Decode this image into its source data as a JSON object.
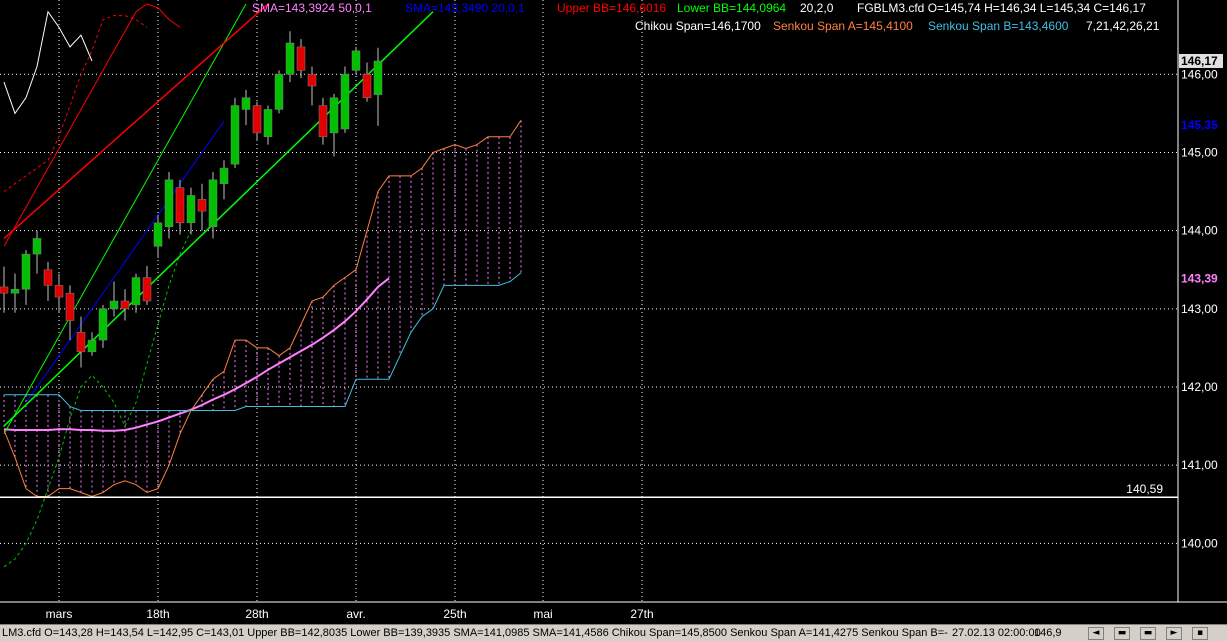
{
  "indicators": {
    "sma1": "SMA=143,3924  50,0,1",
    "sma2": "SMA=145,3490  20,0,1",
    "upper_bb": "Upper BB=146,6016",
    "lower_bb": "Lower BB=144,0964",
    "bb_params": "20,2,0",
    "symbol_ohlc": "FGBLM3.cfd O=145,74 H=146,34 L=145,34 C=146,17",
    "chikou": "Chikou Span=146,1700",
    "senkou_a": "Senkou Span A=145,4100",
    "senkou_b": "Senkou Span B=143,4600",
    "ichimoku_params": "7,21,42,26,21"
  },
  "price_labels": {
    "last": "146,17",
    "sma20": "145,35",
    "sma50": "143,39",
    "hline": "140,59"
  },
  "status": {
    "cursor_data": "LM3.cfd O=143,28 H=143,54 L=142,95 C=143,01  Upper BB=142,8035 Lower BB=139,3935 SMA=141,0985 SMA=141,4586 Chikou Span=145,8500 Senkou Span A=141,4275 Senkou Span B=-",
    "cursor_time": "27.02.13 02:00:00",
    "cursor_price": "146,9"
  },
  "colors": {
    "background": "#000000",
    "grid": "#ffffff",
    "candle_up": "#00c000",
    "candle_down": "#e00000",
    "sma50": "#ff80ff",
    "sma20": "#0000ff",
    "upper_bb": "#ff0000",
    "lower_bb": "#00ff00",
    "senkou_a": "#ff8040",
    "senkou_b": "#40c0e0",
    "chikou": "#ffffff",
    "kumo": "#ff80ff"
  },
  "chart_data": {
    "type": "candlestick",
    "symbol": "FGBLM3.cfd",
    "ylim": [
      139.25,
      146.95
    ],
    "y_ticks": [
      140.0,
      141.0,
      142.0,
      143.0,
      144.0,
      145.0,
      146.0
    ],
    "y_tick_labels": [
      "140,00",
      "141,00",
      "142,00",
      "143,00",
      "144,00",
      "145,00",
      "146,00"
    ],
    "x_tick_labels": [
      "mars",
      "18th",
      "28th",
      "avr.",
      "25th",
      "mai",
      "27th"
    ],
    "x_tick_index": [
      5,
      14,
      23,
      32,
      41,
      49,
      58
    ],
    "bar_count": 60,
    "candles": [
      {
        "o": 143.28,
        "h": 143.54,
        "l": 142.95,
        "c": 143.2
      },
      {
        "o": 143.2,
        "h": 143.45,
        "l": 142.95,
        "c": 143.25
      },
      {
        "o": 143.25,
        "h": 143.75,
        "l": 143.05,
        "c": 143.7
      },
      {
        "o": 143.7,
        "h": 144.0,
        "l": 143.45,
        "c": 143.9
      },
      {
        "o": 143.5,
        "h": 143.6,
        "l": 143.1,
        "c": 143.3
      },
      {
        "o": 143.3,
        "h": 143.45,
        "l": 142.95,
        "c": 143.15
      },
      {
        "o": 143.2,
        "h": 143.3,
        "l": 142.6,
        "c": 142.85
      },
      {
        "o": 142.7,
        "h": 142.9,
        "l": 142.25,
        "c": 142.45
      },
      {
        "o": 142.45,
        "h": 142.7,
        "l": 142.4,
        "c": 142.6
      },
      {
        "o": 142.6,
        "h": 143.05,
        "l": 142.5,
        "c": 143.0
      },
      {
        "o": 143.0,
        "h": 143.35,
        "l": 142.9,
        "c": 143.1
      },
      {
        "o": 143.1,
        "h": 143.25,
        "l": 142.85,
        "c": 143.0
      },
      {
        "o": 143.05,
        "h": 143.45,
        "l": 142.95,
        "c": 143.4
      },
      {
        "o": 143.4,
        "h": 143.55,
        "l": 143.05,
        "c": 143.1
      },
      {
        "o": 143.8,
        "h": 144.2,
        "l": 143.65,
        "c": 144.1
      },
      {
        "o": 144.05,
        "h": 144.75,
        "l": 143.9,
        "c": 144.65
      },
      {
        "o": 144.55,
        "h": 144.65,
        "l": 143.95,
        "c": 144.1
      },
      {
        "o": 144.1,
        "h": 144.55,
        "l": 143.95,
        "c": 144.45
      },
      {
        "o": 144.4,
        "h": 144.6,
        "l": 144.0,
        "c": 144.25
      },
      {
        "o": 144.05,
        "h": 144.75,
        "l": 143.9,
        "c": 144.65
      },
      {
        "o": 144.6,
        "h": 144.9,
        "l": 144.4,
        "c": 144.8
      },
      {
        "o": 144.85,
        "h": 145.7,
        "l": 144.8,
        "c": 145.6
      },
      {
        "o": 145.55,
        "h": 145.8,
        "l": 145.35,
        "c": 145.7
      },
      {
        "o": 145.6,
        "h": 145.65,
        "l": 145.15,
        "c": 145.25
      },
      {
        "o": 145.2,
        "h": 145.6,
        "l": 145.1,
        "c": 145.55
      },
      {
        "o": 145.55,
        "h": 146.05,
        "l": 145.5,
        "c": 146.0
      },
      {
        "o": 146.0,
        "h": 146.55,
        "l": 145.9,
        "c": 146.4
      },
      {
        "o": 146.35,
        "h": 146.45,
        "l": 145.95,
        "c": 146.05
      },
      {
        "o": 146.0,
        "h": 146.1,
        "l": 145.6,
        "c": 145.85
      },
      {
        "o": 145.6,
        "h": 145.7,
        "l": 145.1,
        "c": 145.2
      },
      {
        "o": 145.25,
        "h": 145.75,
        "l": 144.95,
        "c": 145.7
      },
      {
        "o": 145.3,
        "h": 146.1,
        "l": 145.25,
        "c": 146.0
      },
      {
        "o": 146.05,
        "h": 146.35,
        "l": 146.0,
        "c": 146.3
      },
      {
        "o": 146.0,
        "h": 146.15,
        "l": 145.65,
        "c": 145.7
      },
      {
        "o": 145.74,
        "h": 146.34,
        "l": 145.34,
        "c": 146.17
      }
    ],
    "series": [
      {
        "name": "SMA 50,0,1",
        "color": "#ff80ff",
        "start": 0,
        "values": [
          141.46,
          141.45,
          141.45,
          141.45,
          141.45,
          141.46,
          141.46,
          141.45,
          141.45,
          141.44,
          141.44,
          141.45,
          141.48,
          141.52,
          141.56,
          141.61,
          141.66,
          141.71,
          141.77,
          141.84,
          141.9,
          141.97,
          142.05,
          142.13,
          142.22,
          142.3,
          142.38,
          142.46,
          142.54,
          142.63,
          142.73,
          142.84,
          142.97,
          143.12,
          143.28,
          143.39
        ]
      },
      {
        "name": "SMA 20,0,1",
        "color": "#0000ff",
        "start": 2,
        "values": [
          141.8,
          142.0,
          142.2,
          142.4,
          142.6,
          142.8,
          143.0,
          143.2,
          143.4,
          143.6,
          143.8,
          144.0,
          144.2,
          144.4,
          144.6,
          144.8,
          145.0,
          145.2,
          145.4
        ]
      },
      {
        "name": "Upper BB",
        "color": "#ff0000",
        "start": 0,
        "values": [
          143.8,
          144.05,
          144.3,
          144.55,
          144.8,
          145.05,
          145.3,
          145.55,
          145.8,
          146.05,
          146.3,
          146.55,
          146.8,
          146.9,
          146.85,
          146.7,
          146.6
        ]
      },
      {
        "name": "Lower BB",
        "color": "#00ff00",
        "start": 0,
        "values": [
          141.4,
          141.65,
          141.9,
          142.15,
          142.4,
          142.65,
          142.9,
          143.15,
          143.4,
          143.65,
          143.9,
          144.15,
          144.4,
          144.65,
          144.9,
          145.15,
          145.4,
          145.65,
          145.9,
          146.15,
          146.4,
          146.65,
          146.9
        ]
      },
      {
        "name": "Chikou Span",
        "color": "#ffffff",
        "start": 0,
        "values": [
          145.9,
          145.5,
          145.7,
          146.1,
          146.8,
          146.6,
          146.35,
          146.5,
          146.17
        ]
      },
      {
        "name": "Senkou Span A",
        "color": "#ff8040",
        "start": 0,
        "values": [
          141.45,
          141.1,
          140.7,
          140.6,
          140.6,
          140.7,
          140.7,
          140.65,
          140.6,
          140.65,
          140.75,
          140.8,
          140.75,
          140.65,
          140.7,
          141.0,
          141.4,
          141.7,
          141.9,
          142.1,
          142.2,
          142.6,
          142.6,
          142.5,
          142.5,
          142.4,
          142.5,
          142.8,
          143.1,
          143.15,
          143.3,
          143.4,
          143.5,
          144.0,
          144.5,
          144.7,
          144.7,
          144.7,
          144.8,
          145.0,
          145.05,
          145.1,
          145.05,
          145.1,
          145.2,
          145.2,
          145.2,
          145.41
        ]
      },
      {
        "name": "Senkou Span B",
        "color": "#40c0e0",
        "start": 0,
        "values": [
          141.9,
          141.9,
          141.9,
          141.9,
          141.9,
          141.9,
          141.75,
          141.7,
          141.7,
          141.7,
          141.7,
          141.7,
          141.7,
          141.7,
          141.7,
          141.7,
          141.7,
          141.7,
          141.7,
          141.7,
          141.7,
          141.7,
          141.75,
          141.75,
          141.75,
          141.75,
          141.75,
          141.75,
          141.75,
          141.75,
          141.75,
          141.75,
          142.1,
          142.1,
          142.1,
          142.1,
          142.4,
          142.7,
          142.9,
          143.0,
          143.3,
          143.3,
          143.3,
          143.3,
          143.3,
          143.3,
          143.35,
          143.46
        ]
      },
      {
        "name": "Tenkan dashed",
        "color": "#00c000",
        "start": 0,
        "values": [
          139.7,
          139.8,
          140.0,
          140.3,
          140.7,
          141.1,
          141.6,
          142.0,
          142.15,
          142.0,
          141.8,
          141.5,
          141.8,
          142.3,
          142.8,
          143.3,
          143.7,
          144.0
        ]
      },
      {
        "name": "Kijun dashed",
        "color": "#ff0000",
        "start": 0,
        "values": [
          144.5,
          144.6,
          144.7,
          144.8,
          144.9,
          145.2,
          145.6,
          146.0,
          146.3,
          146.7,
          146.75,
          146.75,
          146.7,
          146.6
        ]
      }
    ],
    "hline": 140.59,
    "trendlines": [
      {
        "name": "upper channel",
        "color": "#ff0000",
        "from": {
          "bar": 0,
          "price": 143.9
        },
        "to": {
          "bar": 24,
          "price": 146.9
        }
      },
      {
        "name": "lower channel",
        "color": "#00ff00",
        "from": {
          "bar": 0,
          "price": 141.5
        },
        "to": {
          "bar": 39,
          "price": 146.8
        }
      }
    ]
  }
}
